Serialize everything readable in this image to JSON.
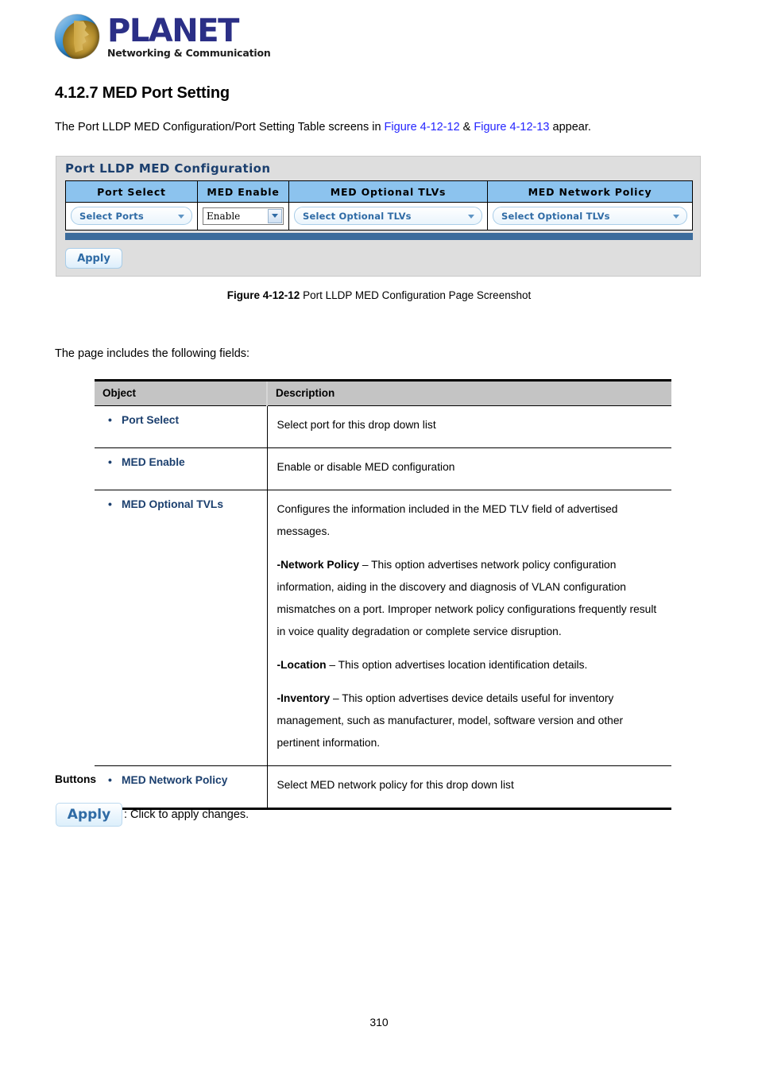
{
  "brand": {
    "name": "PLANET",
    "tagline": "Networking & Communication",
    "logo_icon": "planet-globe-icon"
  },
  "section": {
    "number_title": "4.12.7 MED Port Setting",
    "intro_prefix": "The Port LLDP MED Configuration/Port Setting Table screens in ",
    "xref_1": "Figure 4-12-12",
    "intro_mid": " & ",
    "xref_2": "Figure 4-12-13",
    "intro_suffix": " appear."
  },
  "panel": {
    "title": "Port LLDP MED Configuration",
    "headers": {
      "port_select": "Port Select",
      "med_enable": "MED Enable",
      "med_optional_tlvs": "MED Optional TLVs",
      "med_network_policy": "MED Network Policy"
    },
    "controls": {
      "port_select_value": "Select Ports",
      "med_enable_value": "Enable",
      "med_optional_tlvs_value": "Select Optional TLVs",
      "med_network_policy_value": "Select Optional TLVs"
    },
    "apply_label": "Apply",
    "colors": {
      "header_blue": "#8cc3ee",
      "footer_blue": "#3c6c9c",
      "panel_gray": "#dedede",
      "title_navy": "#1b3f6e"
    }
  },
  "figure_caption": {
    "label": "Figure 4-12-12",
    "text": " Port LLDP MED Configuration Page Screenshot"
  },
  "fields_note": "The page includes the following fields:",
  "table": {
    "headers": [
      "Object",
      "Description"
    ],
    "rows": [
      {
        "object": "Port Select",
        "description": [
          "Select port for this drop down list"
        ]
      },
      {
        "object": "MED Enable",
        "description": [
          "Enable or disable MED configuration"
        ]
      },
      {
        "object": "MED Optional TVLs",
        "description": [
          "Configures the information included in the MED TLV field of advertised messages.",
          "-Network Policy – This option advertises network policy configuration information, aiding in the discovery and diagnosis of VLAN configuration mismatches on a port. Improper network policy configurations frequently result in voice quality degradation or complete service disruption.",
          "-Location – This option advertises location identification details.",
          "-Inventory – This option advertises device details useful for inventory management, such as manufacturer, model, software version and other pertinent information."
        ],
        "bold_leads": [
          "",
          "-Network Policy",
          "-Location",
          "-Inventory"
        ]
      },
      {
        "object": "MED Network Policy",
        "description": [
          "Select MED network policy for this drop down list"
        ]
      }
    ]
  },
  "buttons_section": {
    "heading": "Buttons",
    "apply_label": "Apply",
    "apply_description": ": Click to apply changes."
  },
  "page_number": "310"
}
